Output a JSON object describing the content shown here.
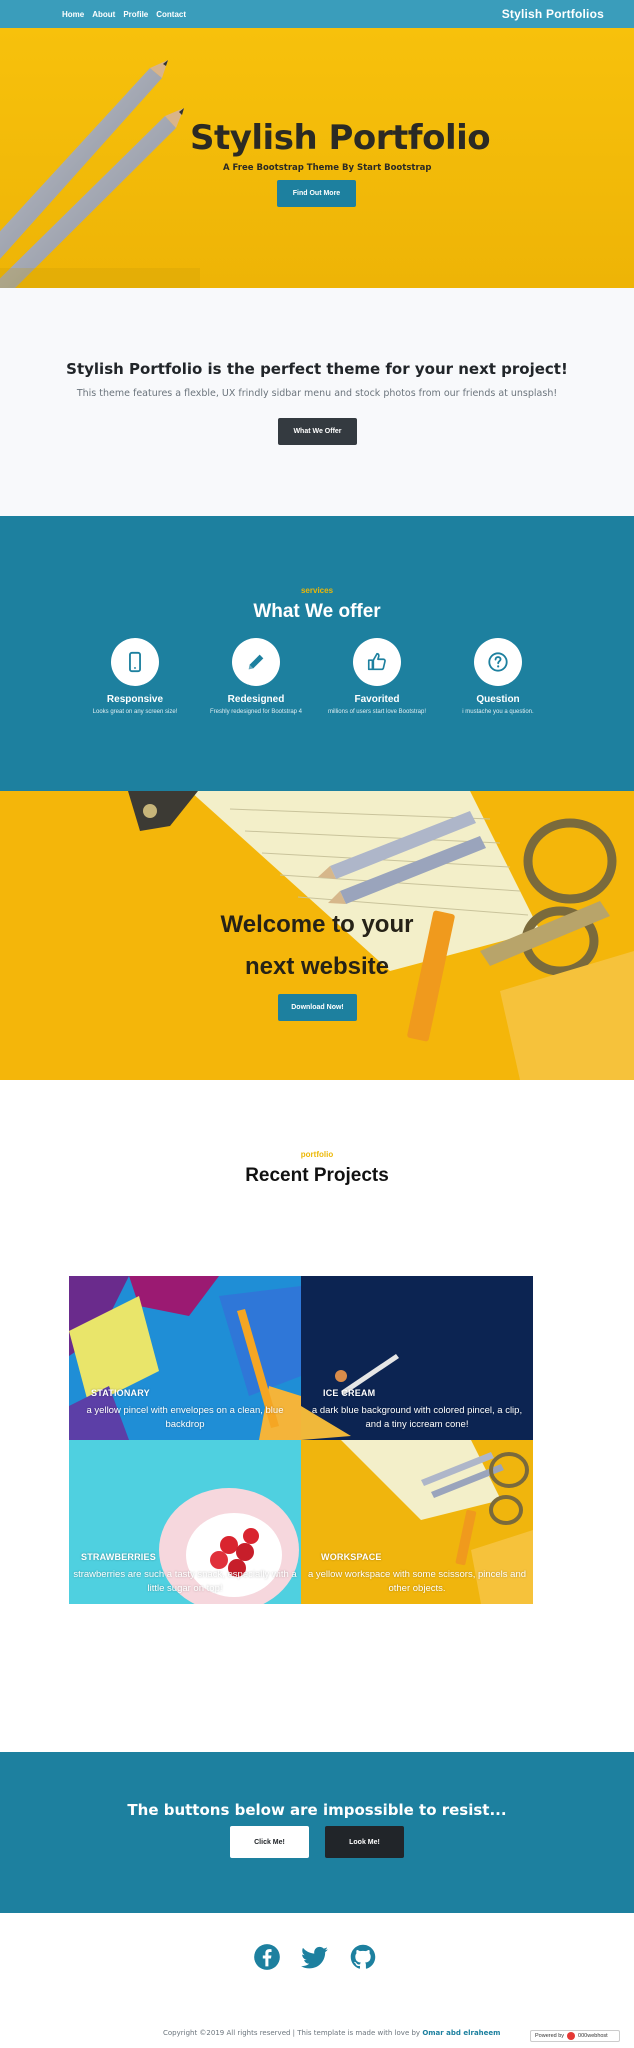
{
  "nav": {
    "links": [
      "Home",
      "About",
      "Profile",
      "Contact"
    ],
    "brand": "Stylish Portfolios"
  },
  "hero": {
    "title": "Stylish Portfolio",
    "subtitle": "A Free Bootstrap Theme By Start Bootstrap",
    "button": "Find Out More"
  },
  "about": {
    "title": "Stylish Portfolio is the perfect theme for your next project!",
    "text": "This theme features a flexble, UX frindly sidbar menu and stock photos from our friends at unsplash!",
    "button": "What We Offer"
  },
  "services": {
    "kicker": "services",
    "title": "What We offer",
    "items": [
      {
        "title": "Responsive",
        "text": "Looks great on any screen size!",
        "icon": "mobile-phone-icon"
      },
      {
        "title": "Redesigned",
        "text": "Freshly redesigned for Bootstrap 4",
        "icon": "pencil-icon"
      },
      {
        "title": "Favorited",
        "text": "millions of users start love Bootstrap!",
        "icon": "thumbs-up-icon"
      },
      {
        "title": "Question",
        "text": "i mustache you a question.",
        "icon": "question-icon"
      }
    ]
  },
  "callout": {
    "line1": "Welcome to your",
    "line2": "next website",
    "button": "Download Now!"
  },
  "portfolio": {
    "kicker": "portfolio",
    "title": "Recent Projects",
    "items": [
      {
        "name": "STATIONARY",
        "desc": "a yellow pincel with envelopes on a clean, blue backdrop"
      },
      {
        "name": "ICE CREAM",
        "desc": "a dark blue background with colored pincel, a clip, and a tiny iccream cone!"
      },
      {
        "name": "STRAWBERRIES",
        "desc": "strawberries are such a tasty snack, especially with a little sugar on top!"
      },
      {
        "name": "WORKSPACE",
        "desc": "a yellow workspace with some scissors, pincels and other objects."
      }
    ]
  },
  "cta": {
    "title": "The buttons below are impossible to resist...",
    "button1": "Click Me!",
    "button2": "Look Me!"
  },
  "footer": {
    "copyright": "Copyright ©2019 All rights reserved | This template is made with love by ",
    "author": "Omar abd elraheem",
    "powered": "Powered by",
    "powered_brand": "000webhost",
    "socials": [
      "facebook-icon",
      "twitter-icon",
      "github-icon"
    ]
  },
  "colors": {
    "primary": "#1d809f",
    "accent": "#ecb807",
    "dark": "#212529",
    "nav": "#3a9dbb"
  }
}
